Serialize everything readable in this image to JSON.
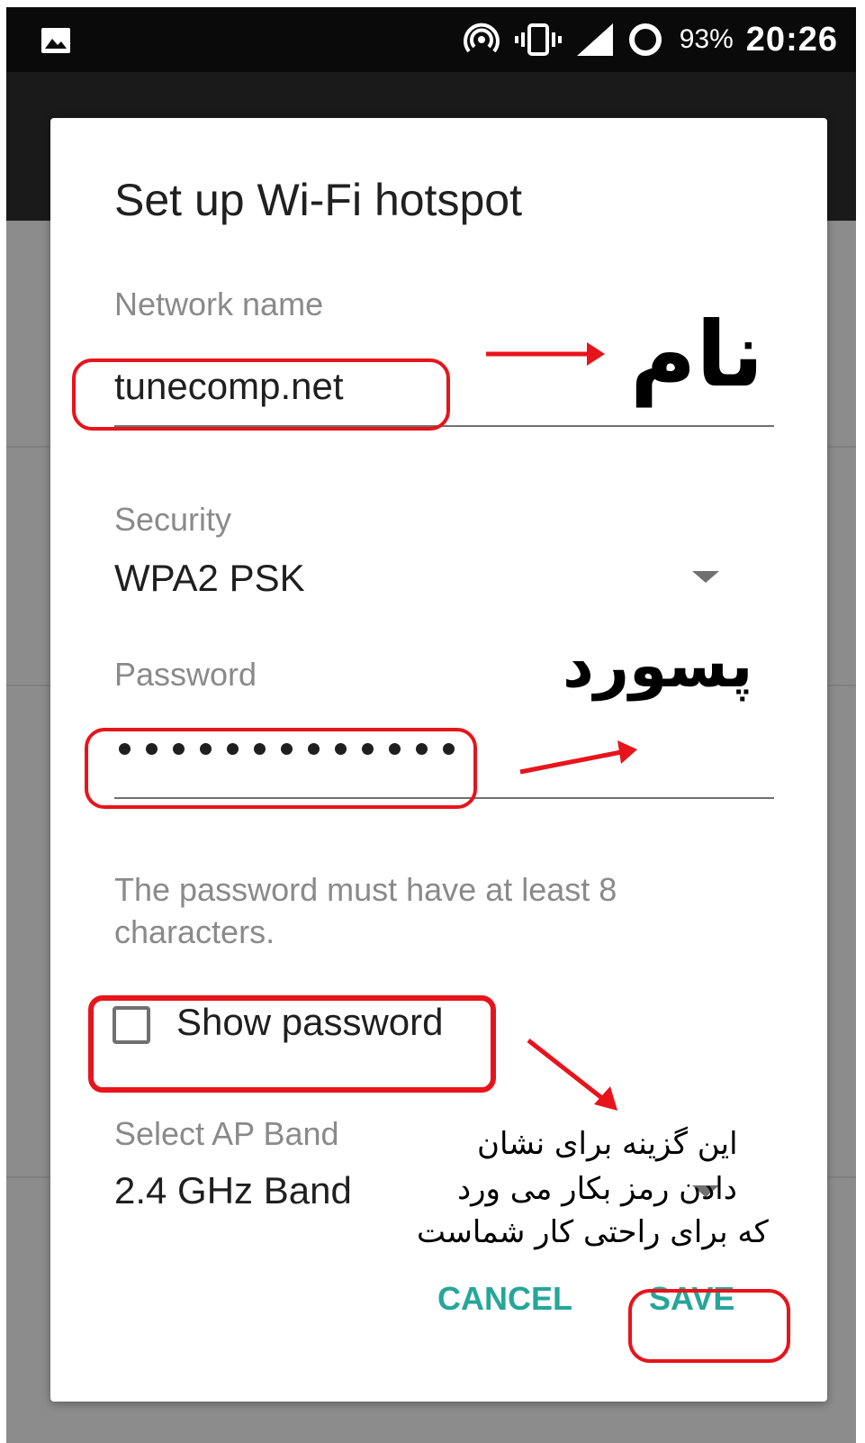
{
  "status_bar": {
    "battery": "93%",
    "time": "20:26",
    "icons": [
      "image-icon",
      "hotspot-icon",
      "vibrate-icon",
      "signal-icon",
      "sync-icon"
    ]
  },
  "dialog": {
    "title": "Set up Wi-Fi hotspot",
    "network_name": {
      "label": "Network name",
      "value": "tunecomp.net"
    },
    "security": {
      "label": "Security",
      "value": "WPA2 PSK"
    },
    "password": {
      "label": "Password",
      "masked_length": 13,
      "helper": "The password must have at least 8 characters."
    },
    "show_password": {
      "label": "Show password",
      "checked": false
    },
    "ap_band": {
      "label": "Select AP Band",
      "value": "2.4 GHz Band"
    },
    "buttons": {
      "cancel": "CANCEL",
      "save": "SAVE"
    }
  },
  "annotations": {
    "name_note": "نام",
    "password_note": "پسورد",
    "show_password_note": {
      "line1": "این گزینه برای نشان",
      "line2": "دادن رمز  بکار می ورد",
      "line3": "که برای راحتی کار شماست"
    },
    "highlight_color": "#e8141b"
  },
  "colors": {
    "accent": "#26a69a",
    "status_bar": "#0a0a0a",
    "scrim": "#8c8c8c"
  }
}
